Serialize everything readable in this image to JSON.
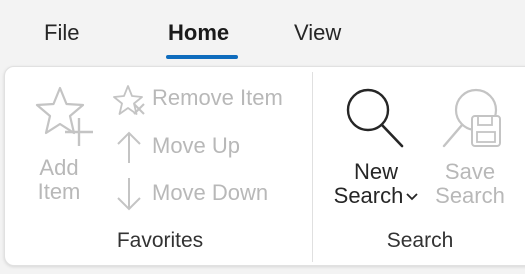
{
  "tabs": {
    "file": "File",
    "home": "Home",
    "view": "View"
  },
  "favorites": {
    "add_item_line1": "Add",
    "add_item_line2": "Item",
    "remove_item": "Remove Item",
    "move_up": "Move Up",
    "move_down": "Move Down",
    "group_label": "Favorites"
  },
  "search": {
    "new_search_line1": "New",
    "new_search_line2": "Search",
    "save_search_line1": "Save",
    "save_search_line2": "Search",
    "group_label": "Search"
  },
  "icons": {
    "add_item": "star-plus-icon",
    "remove_item": "star-remove-icon",
    "move_up": "arrow-up-icon",
    "move_down": "arrow-down-icon",
    "new_search": "search-icon",
    "save_search": "search-save-icon",
    "dropdown": "chevron-down-icon"
  },
  "colors": {
    "accent": "#0f6cbd",
    "disabled_text": "#b8b8b8",
    "text": "#262626"
  }
}
